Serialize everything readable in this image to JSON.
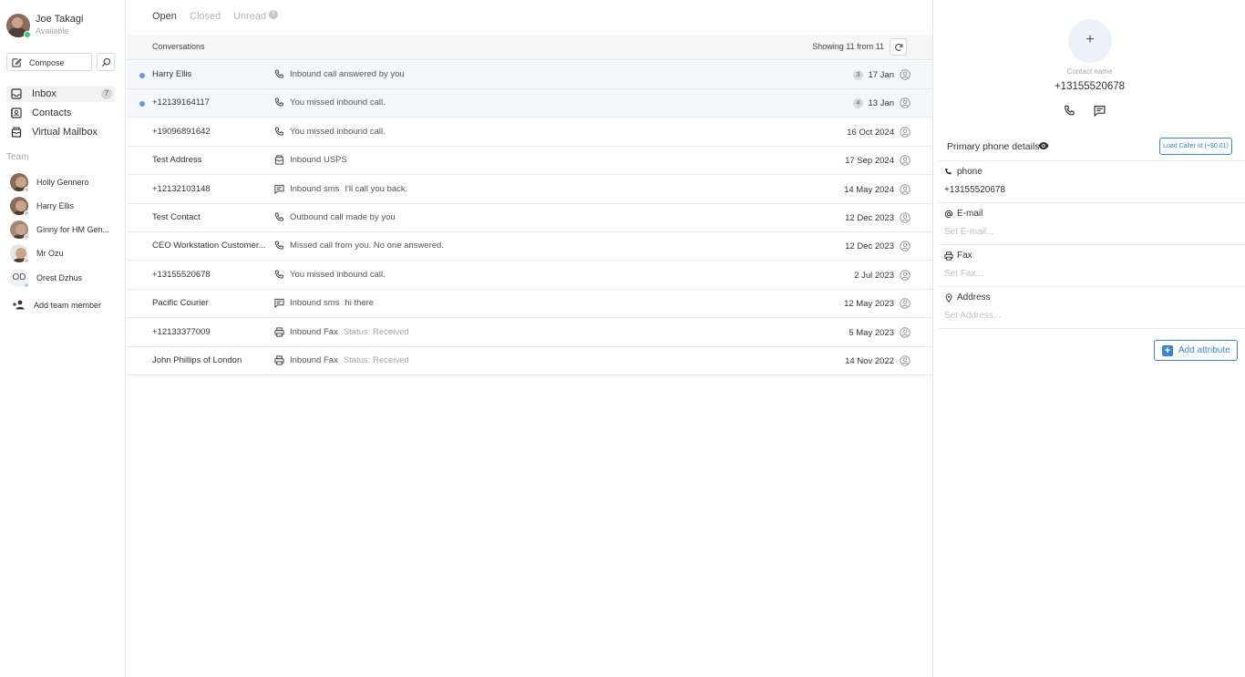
{
  "user": {
    "name": "Joe Takagi",
    "status": "Available"
  },
  "compose": {
    "label": "Compose"
  },
  "nav": [
    {
      "label": "Inbox",
      "count": "7",
      "icon": "inbox-icon"
    },
    {
      "label": "Contacts",
      "icon": "contacts-icon"
    },
    {
      "label": "Virtual Mailbox",
      "icon": "mailbox-icon"
    }
  ],
  "team": {
    "title": "Team",
    "members": [
      {
        "name": "Holly Gennero"
      },
      {
        "name": "Harry Ellis"
      },
      {
        "name": "Ginny for HM Gen..."
      },
      {
        "name": "Mr Ozu"
      },
      {
        "name": "Orest Dzhus",
        "initials": "OD"
      }
    ],
    "add_label": "Add team member"
  },
  "tabs": {
    "open": "Open",
    "closed": "Closed",
    "unread": "Unread",
    "unread_count": "7"
  },
  "conversations": {
    "title": "Conversations",
    "showing": "Showing 11 from 11",
    "rows": [
      {
        "name": "Harry Ellis",
        "icon": "phone-icon",
        "message": "Inbound call answered by you",
        "extra": "",
        "count": "3",
        "date": "17 Jan",
        "unread": true
      },
      {
        "name": "+12139164117",
        "icon": "phone-icon",
        "message": "You missed inbound call.",
        "extra": "",
        "count": "4",
        "date": "13 Jan",
        "unread": true
      },
      {
        "name": "+19096891642",
        "icon": "phone-icon",
        "message": "You missed inbound call.",
        "extra": "",
        "count": "",
        "date": "16 Oct 2024",
        "unread": false
      },
      {
        "name": "Test Address",
        "icon": "mailbox-icon",
        "message": "Inbound USPS",
        "extra": "",
        "count": "",
        "date": "17 Sep 2024",
        "unread": false
      },
      {
        "name": "+12132103148",
        "icon": "sms-icon",
        "message": "Inbound sms",
        "extra": "I'll call you back.",
        "count": "",
        "date": "14 May 2024",
        "unread": false
      },
      {
        "name": "Test Contact",
        "icon": "phone-icon",
        "message": "Outbound call made by you",
        "extra": "",
        "count": "",
        "date": "12 Dec 2023",
        "unread": false
      },
      {
        "name": "CEO Workstation Customer...",
        "icon": "phone-icon",
        "message": "Missed call from you. No one answered.",
        "extra": "",
        "count": "",
        "date": "12 Dec 2023",
        "unread": false
      },
      {
        "name": "+13155520678",
        "icon": "phone-icon",
        "message": "You missed inbound call.",
        "extra": "",
        "count": "",
        "date": "2 Jul 2023",
        "unread": false
      },
      {
        "name": "Pacific Courier",
        "icon": "sms-icon",
        "message": "Inbound sms",
        "extra": "hi there",
        "count": "",
        "date": "12 May 2023",
        "unread": false
      },
      {
        "name": "+12133377009",
        "icon": "fax-icon",
        "message": "Inbound Fax",
        "extra": "Status: Received",
        "extra_grey": true,
        "count": "",
        "date": "5 May 2023",
        "unread": false
      },
      {
        "name": "John Phillips of London",
        "icon": "fax-icon",
        "message": "Inbound Fax",
        "extra": "Status: Received",
        "extra_grey": true,
        "count": "",
        "date": "14 Nov 2022",
        "unread": false
      }
    ]
  },
  "contact": {
    "add_symbol": "+",
    "label": "Contact name",
    "phone": "+13155520678",
    "primary_title": "Primary phone details",
    "caller_id_button": "Load Caller Id (+$0.01)",
    "attributes": [
      {
        "label": "phone",
        "value": "+13155520678",
        "placeholder": false,
        "icon": "phone-icon"
      },
      {
        "label": "E-mail",
        "value": "Set E-mail...",
        "placeholder": true,
        "icon": "at-icon"
      },
      {
        "label": "Fax",
        "value": "Set Fax...",
        "placeholder": true,
        "icon": "fax-icon"
      },
      {
        "label": "Address",
        "value": "Set Address...",
        "placeholder": true,
        "icon": "location-icon"
      }
    ],
    "add_attribute": "Add attribute"
  },
  "colors": {
    "accent": "#3b84d6",
    "unread_dot": "#5d9ce8",
    "online": "#2ecc71"
  }
}
